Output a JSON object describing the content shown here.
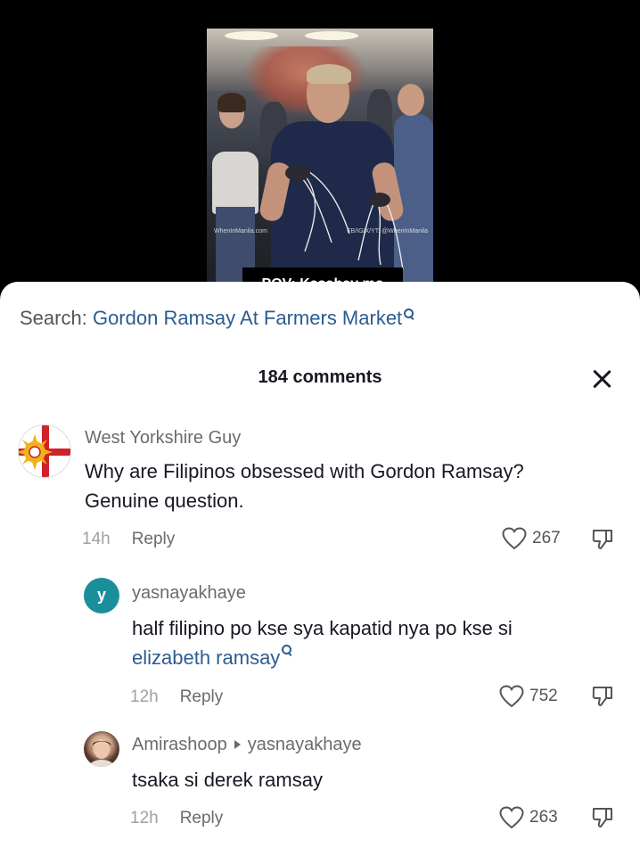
{
  "video": {
    "watermark_left": "WhenInManila.com",
    "watermark_right": "FB/IG/X/YT: @WhenInManila",
    "caption": "POV: Kasabay mo"
  },
  "search": {
    "prefix": "Search:",
    "query": "Gordon Ramsay At Farmers Market"
  },
  "header": {
    "comments_count": "184 comments"
  },
  "comments": [
    {
      "username": "West Yorkshire Guy",
      "text_line1": "Why are Filipinos obsessed with Gordon Ramsay?",
      "text_line2": "Genuine question.",
      "time": "14h",
      "reply_label": "Reply",
      "likes": "267"
    },
    {
      "avatar_letter": "y",
      "username": "yasnayakhaye",
      "text_line1": "half filipino po kse sya kapatid nya po kse si",
      "text_link": "elizabeth ramsay",
      "time": "12h",
      "reply_label": "Reply",
      "likes": "752"
    },
    {
      "username": "Amirashoop",
      "reply_to": "yasnayakhaye",
      "text_line1": "tsaka si derek ramsay",
      "time": "12h",
      "reply_label": "Reply",
      "likes": "263"
    }
  ],
  "colors": {
    "link": "#2c5c8f",
    "avatar_y": "#1b8e9c"
  }
}
